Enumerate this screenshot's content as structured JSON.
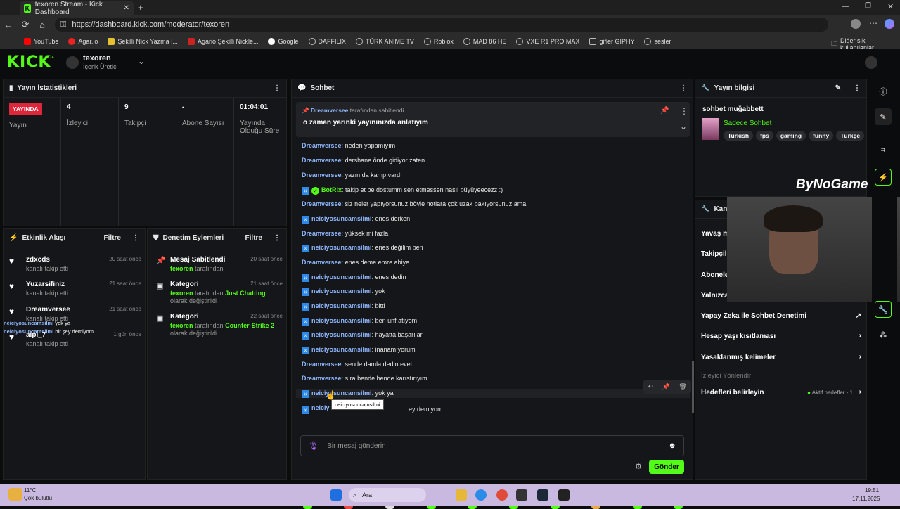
{
  "browser": {
    "tab_title": "texoren Stream - Kick Dashboard",
    "url": "https://dashboard.kick.com/moderator/texoren",
    "bookmarks": [
      "YouTube",
      "Agar.io",
      "Şekilli Nick Yazma |...",
      "Agario Şekilli Nickle...",
      "Google",
      "DAFFILIX",
      "TÜRK ANIME TV",
      "Roblox",
      "MAD 86 HE",
      "VXE R1 PRO MAX",
      "gifler GIPHY",
      "sesler"
    ],
    "other_bookmarks": "Diğer sık kullanılanlar"
  },
  "header": {
    "logo": "KICK",
    "beta": "BETA",
    "channel": "texoren",
    "role": "İçerik Üretici"
  },
  "stats": {
    "title": "Yayın İstatistikleri",
    "live_badge": "YAYINDA",
    "live_label": "Yayın",
    "viewers": "4",
    "viewers_label": "İzleyici",
    "followers": "9",
    "followers_label": "Takipçi",
    "subs": "-",
    "subs_label": "Abone Sayısı",
    "duration": "01:04:01",
    "duration_label": "Yayında Olduğu Süre"
  },
  "activity": {
    "title": "Etkinlik Akışı",
    "filter": "Filtre",
    "items": [
      {
        "name": "zdxcds",
        "sub": "kanalı takip etti",
        "time": "20 saat önce"
      },
      {
        "name": "Yuzarsifiniz",
        "sub": "kanalı takip etti",
        "time": "21 saat önce"
      },
      {
        "name": "Dreamversee",
        "sub": "kanalı takip etti",
        "time": "21 saat önce"
      },
      {
        "name": "aipi_7",
        "sub": "kanalı takip etti",
        "time": "1 gün önce"
      }
    ],
    "overlay1_user": "neiciyosuncamsilmi",
    "overlay1_text": "yok ya",
    "overlay2_user": "neiciyosuncamsilmi",
    "overlay2_text": "bir şey demiyom"
  },
  "moderation": {
    "title": "Denetim Eylemleri",
    "filter": "Filtre",
    "items": [
      {
        "title": "Mesaj Sabitlendi",
        "user": "texoren",
        "rest": "tarafından",
        "time": "20 saat önce"
      },
      {
        "title": "Kategori",
        "user": "texoren",
        "rest": "tarafından",
        "cat": "Just Chatting",
        "rest2": "olarak değiştirildi",
        "time": "21 saat önce"
      },
      {
        "title": "Kategori",
        "user": "texoren",
        "rest": "tarafından",
        "cat": "Counter-Strike 2",
        "rest2": "olarak değiştirildi",
        "time": "22 saat önce"
      }
    ]
  },
  "chat": {
    "title": "Sohbet",
    "pinned_by": "Dreamversee",
    "pinned_by_rest": "tarafından sabitlendi",
    "pinned_text": "o zaman yarınki yayınınızda anlatıyım",
    "messages": [
      {
        "user": "Dreamversee",
        "text": "neden yapamıyım",
        "mod": false
      },
      {
        "user": "Dreamversee",
        "text": "dershane önde gidiyor zaten",
        "mod": false
      },
      {
        "user": "Dreamversee",
        "text": "yazın da kamp vardı",
        "mod": false
      },
      {
        "user": "BotRix",
        "text": "takip et be dostumm sen etmessen nasıl büyüyeecezz :)",
        "mod": true,
        "bot": true
      },
      {
        "user": "Dreamversee",
        "text": "siz neler yapıyorsunuz böyle notlara çok uzak bakıyorsunuz ama",
        "mod": false
      },
      {
        "user": "neiciyosuncamsilmi",
        "text": "enes derken",
        "mod": true
      },
      {
        "user": "Dreamversee",
        "text": "yüksek mi fazla",
        "mod": false
      },
      {
        "user": "neiciyosuncamsilmi",
        "text": "enes değilim ben",
        "mod": true
      },
      {
        "user": "Dreamversee",
        "text": "enes deme emre abiye",
        "mod": false
      },
      {
        "user": "neiciyosuncamsilmi",
        "text": "enes dedin",
        "mod": true
      },
      {
        "user": "neiciyosuncamsilmi",
        "text": "yok",
        "mod": true
      },
      {
        "user": "neiciyosuncamsilmi",
        "text": "bitti",
        "mod": true
      },
      {
        "user": "neiciyosuncamsilmi",
        "text": "ben unf atıyom",
        "mod": true
      },
      {
        "user": "neiciyosuncamsilmi",
        "text": "hayatta başarılar",
        "mod": true
      },
      {
        "user": "neiciyosuncamsilmi",
        "text": "inanamıyorum",
        "mod": true
      },
      {
        "user": "Dreamversee",
        "text": "sende damla dedin evet",
        "mod": false
      },
      {
        "user": "Dreamversee",
        "text": "sıra bende bende karıstırıyım",
        "mod": false
      },
      {
        "user": "neiciyosuncamsilmi",
        "text": "yok ya",
        "mod": true
      },
      {
        "user": "neiciy",
        "text": "ey demiyom",
        "mod": true
      }
    ],
    "tooltip": "neiciyosuncamsilmi",
    "input_placeholder": "Bir mesaj gönderin",
    "send": "Gönder"
  },
  "stream_info": {
    "title": "Yayın bilgisi",
    "stream_title": "sohbet muğabbett",
    "category": "Sadece Sohbet",
    "tags": [
      "Turkish",
      "fps",
      "gaming",
      "funny",
      "Türkçe"
    ]
  },
  "channel_settings": {
    "title": "Kana",
    "items": [
      "Yavaş m",
      "Takipçile",
      "Abonele",
      "Yalnızca"
    ],
    "ai": "Yapay Zeka ile Sohbet Denetimi",
    "age": "Hesap yaşı kısıtlaması",
    "banned": "Yasaklanmış kelimeler",
    "viewer_direct": "İzleyici Yönlendir",
    "goals": "Hedefleri belirleyin",
    "active_goals": "Aktif hedefler - 1"
  },
  "overlay": {
    "brand": "ByNoGame"
  },
  "taskbar": {
    "temp": "11°C",
    "weather": "Çok bulutlu",
    "search": "Ara",
    "time": "19:51",
    "date": "17.11.2025"
  }
}
